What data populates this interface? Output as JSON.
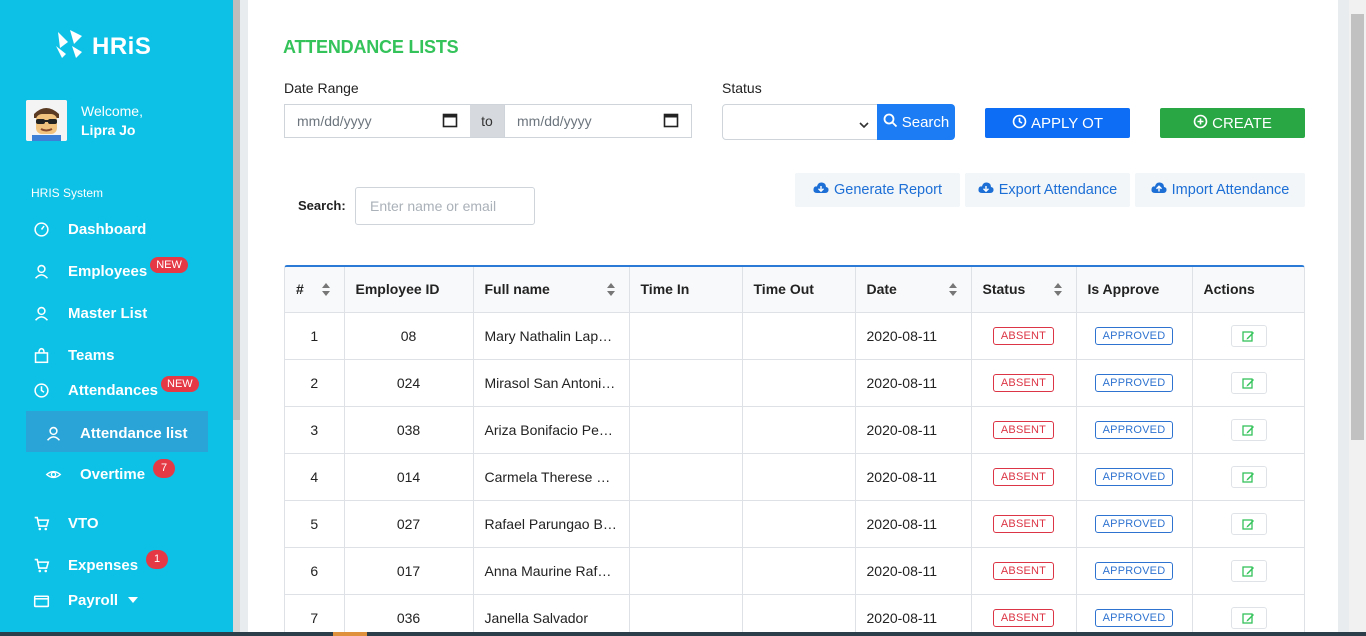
{
  "brand": {
    "name": "HRiS"
  },
  "user": {
    "welcome": "Welcome,",
    "name": "Lipra Jo"
  },
  "sidebar": {
    "section_label": "HRIS System",
    "items": [
      {
        "label": "Dashboard"
      },
      {
        "label": "Employees",
        "badge": "NEW"
      },
      {
        "label": "Master List"
      },
      {
        "label": "Teams"
      },
      {
        "label": "Attendances",
        "badge": "NEW"
      },
      {
        "label": "Attendance list"
      },
      {
        "label": "Overtime",
        "badge": "7"
      },
      {
        "label": "VTO"
      },
      {
        "label": "Expenses",
        "badge": "1"
      },
      {
        "label": "Payroll"
      }
    ]
  },
  "page": {
    "title": "ATTENDANCE LISTS",
    "date_range_label": "Date Range",
    "date_from_placeholder": "mm/dd/yyyy",
    "to_label": "to",
    "date_to_placeholder": "mm/dd/yyyy",
    "status_label": "Status",
    "search_button": "Search",
    "apply_ot_button": "APPLY OT",
    "create_button": "CREATE",
    "generate_report": "Generate Report",
    "export_attendance": "Export Attendance",
    "import_attendance": "Import Attendance",
    "search_label": "Search:",
    "search_placeholder": "Enter name or email"
  },
  "table": {
    "headers": [
      "#",
      "Employee ID",
      "Full name",
      "Time In",
      "Time Out",
      "Date",
      "Status",
      "Is Approve",
      "Actions"
    ],
    "rows": [
      {
        "num": "1",
        "emp_id": "08",
        "name": "Mary Nathalin Lape…",
        "time_in": "",
        "time_out": "",
        "date": "2020-08-11",
        "status": "ABSENT",
        "approve": "APPROVED"
      },
      {
        "num": "2",
        "emp_id": "024",
        "name": "Mirasol San Antoni…",
        "time_in": "",
        "time_out": "",
        "date": "2020-08-11",
        "status": "ABSENT",
        "approve": "APPROVED"
      },
      {
        "num": "3",
        "emp_id": "038",
        "name": "Ariza Bonifacio Perez",
        "time_in": "",
        "time_out": "",
        "date": "2020-08-11",
        "status": "ABSENT",
        "approve": "APPROVED"
      },
      {
        "num": "4",
        "emp_id": "014",
        "name": "Carmela Therese Cr…",
        "time_in": "",
        "time_out": "",
        "date": "2020-08-11",
        "status": "ABSENT",
        "approve": "APPROVED"
      },
      {
        "num": "5",
        "emp_id": "027",
        "name": "Rafael Parungao Ba…",
        "time_in": "",
        "time_out": "",
        "date": "2020-08-11",
        "status": "ABSENT",
        "approve": "APPROVED"
      },
      {
        "num": "6",
        "emp_id": "017",
        "name": "Anna Maurine Rafal…",
        "time_in": "",
        "time_out": "",
        "date": "2020-08-11",
        "status": "ABSENT",
        "approve": "APPROVED"
      },
      {
        "num": "7",
        "emp_id": "036",
        "name": "Janella Salvador",
        "time_in": "",
        "time_out": "",
        "date": "2020-08-11",
        "status": "ABSENT",
        "approve": "APPROVED"
      }
    ]
  },
  "colors": {
    "sidebar": "#0dc1e6",
    "title": "#34c35a",
    "primary": "#0d6ef5",
    "success": "#29a744",
    "danger": "#dc3545"
  },
  "icons": [
    "logo-icon",
    "avatar",
    "dashboard-icon",
    "user-icon",
    "bag-icon",
    "clock-icon",
    "eye-icon",
    "cart-icon",
    "wallet-icon",
    "calendar-icon",
    "search-icon",
    "clock-icon",
    "plus-circle-icon",
    "cloud-download-icon",
    "cloud-upload-icon",
    "sort-icon",
    "edit-icon"
  ]
}
